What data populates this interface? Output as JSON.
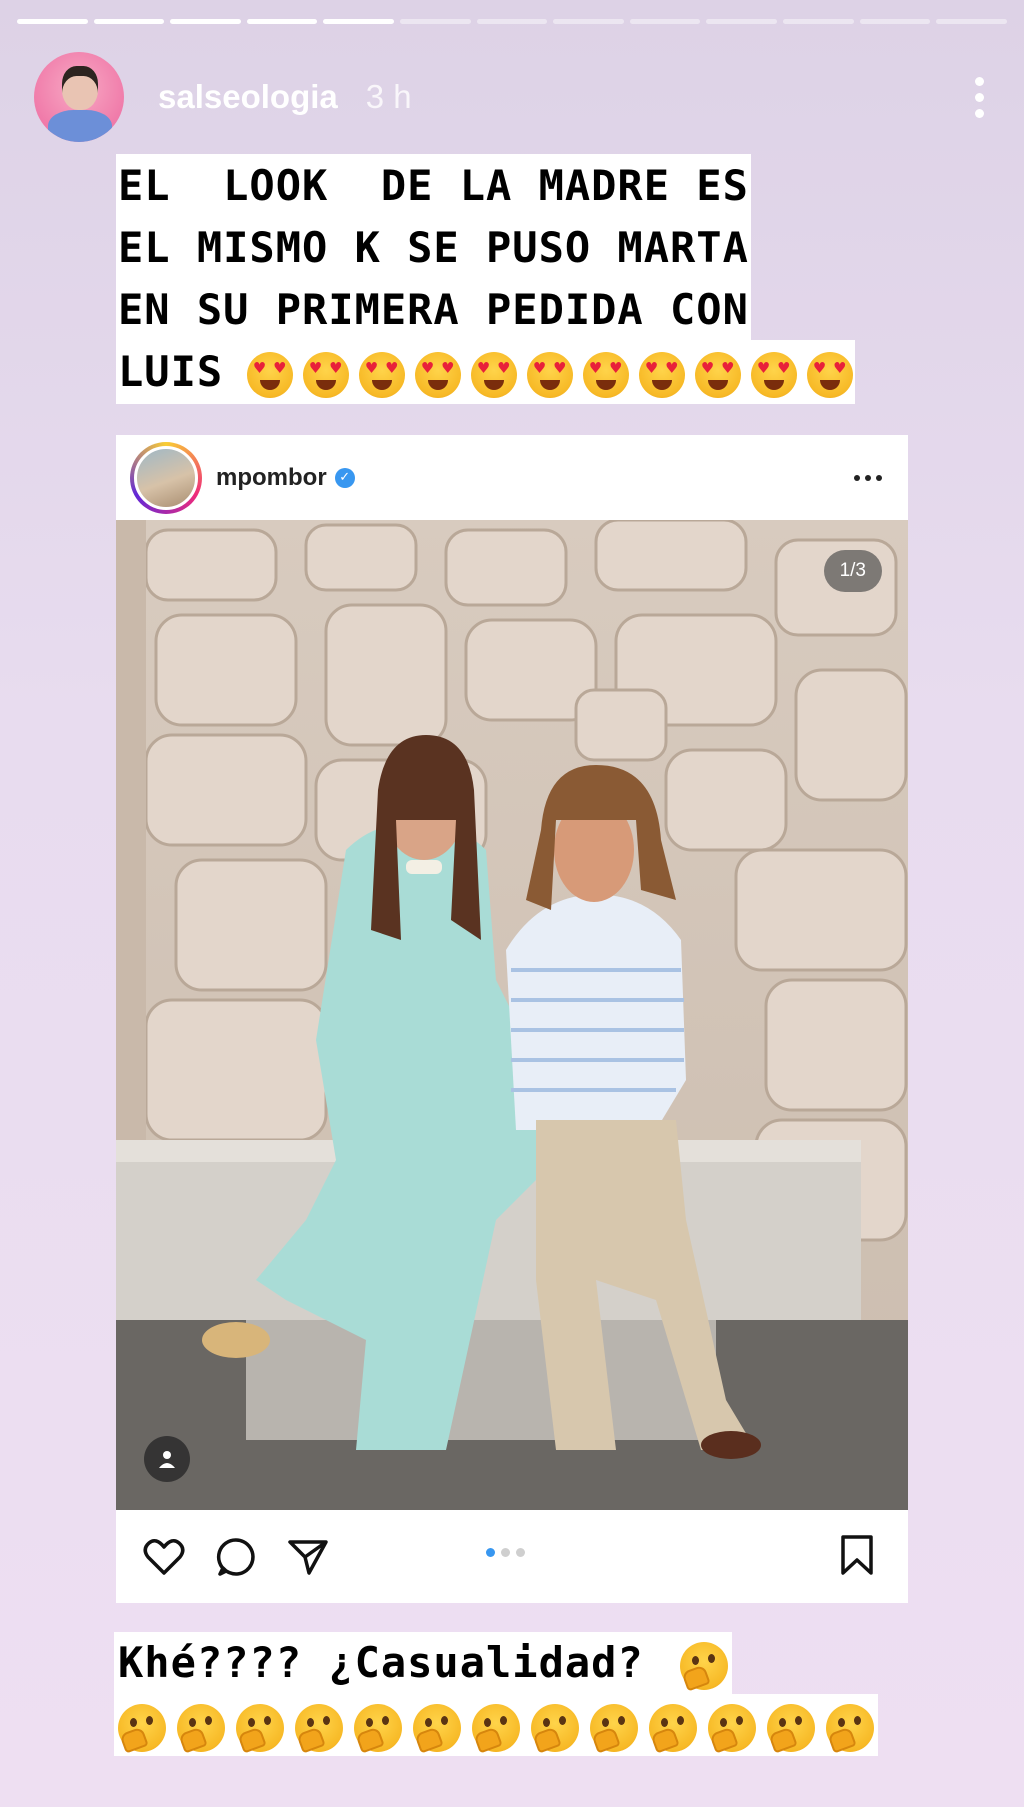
{
  "story": {
    "segments_total": 13,
    "segments_done": 5,
    "username": "salseologia",
    "time_ago": "3 h",
    "caption_top_lines": [
      "EL  LOOK  DE LA MADRE ES",
      "EL MISMO K SE PUSO MARTA",
      "EN SU PRIMERA PEDIDA CON",
      "LUIS"
    ],
    "caption_top_emoji_count": 11,
    "caption_top_emoji": "heart-eyes-emoji",
    "caption_bottom_line": "Khé???? ¿Casualidad?",
    "caption_bottom_emoji_count": 13,
    "caption_bottom_emoji": "thinking-face-emoji"
  },
  "post": {
    "username": "mpombor",
    "verified": true,
    "image_counter": "1/3",
    "carousel_dots": 3,
    "carousel_active": 0
  },
  "colors": {
    "verified_blue": "#3897f0",
    "story_bg": "#e8dcef"
  }
}
